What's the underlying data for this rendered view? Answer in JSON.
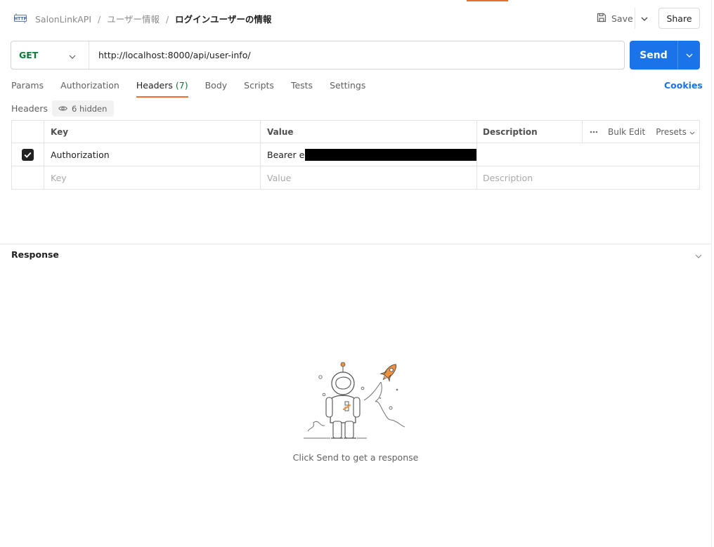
{
  "header": {
    "icon": "http-icon",
    "breadcrumb": [
      "SalonLinkAPI",
      "ユーザー情報"
    ],
    "breadcrumb_separator": "/",
    "current": "ログインユーザーの情報",
    "save_label": "Save",
    "share_label": "Share"
  },
  "request": {
    "method": "GET",
    "url": "http://localhost:8000/api/user-info/",
    "send_label": "Send"
  },
  "tabs": {
    "items": [
      "Params",
      "Authorization",
      "Headers",
      "Body",
      "Scripts",
      "Tests",
      "Settings"
    ],
    "active": "Headers",
    "headers_count": "(7)",
    "cookies_label": "Cookies"
  },
  "headers_section": {
    "label": "Headers",
    "hidden_badge": "6 hidden",
    "columns": {
      "key": "Key",
      "value": "Value",
      "description": "Description"
    },
    "bulk_edit": "Bulk Edit",
    "presets": "Presets",
    "rows": [
      {
        "checked": true,
        "key": "Authorization",
        "value": "Bearer e",
        "value_redacted": true,
        "description": ""
      }
    ],
    "placeholders": {
      "key": "Key",
      "value": "Value",
      "description": "Description"
    }
  },
  "response": {
    "title": "Response",
    "empty_hint": "Click Send to get a response"
  },
  "colors": {
    "accent": "#1a73e8",
    "method_get": "#0b7a38",
    "active_tab_underline": "#e8702a",
    "illustration_orange": "#f0923b"
  }
}
